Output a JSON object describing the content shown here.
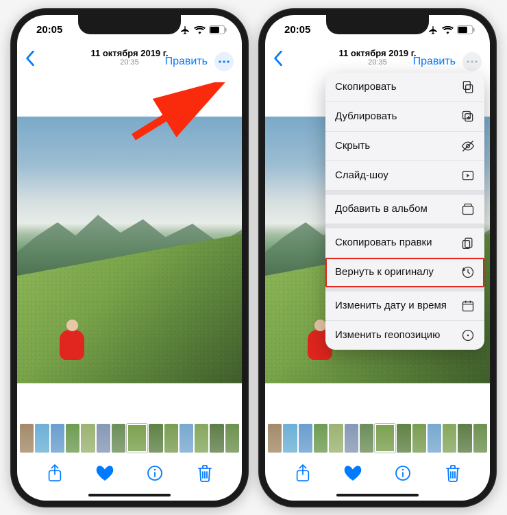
{
  "status": {
    "time": "20:05"
  },
  "header": {
    "date": "11 октября 2019 г.",
    "time": "20:35",
    "edit": "Править"
  },
  "menu": {
    "copy": "Скопировать",
    "duplicate": "Дублировать",
    "hide": "Скрыть",
    "slideshow": "Слайд-шоу",
    "add_to_album": "Добавить в альбом",
    "copy_edits": "Скопировать правки",
    "revert": "Вернуть к оригиналу",
    "adjust_date": "Изменить дату и время",
    "adjust_location": "Изменить геопозицию"
  },
  "thumbs": [
    "#a48a6a",
    "#6db0d6",
    "#6a9ecf",
    "#6e9c52",
    "#9bb372",
    "#8698b5",
    "#6c8e5a",
    "#7ba04f",
    "#5f8245",
    "#7a9d52",
    "#78a8cf",
    "#86a75e",
    "#5f7d48",
    "#6e9150"
  ],
  "colors": {
    "accent": "#007aff",
    "arrow": "#fa2a0c",
    "highlight": "#e0261e"
  }
}
